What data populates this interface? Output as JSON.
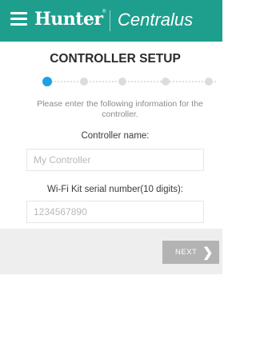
{
  "header": {
    "brand": "Hunter",
    "registered_mark": "®",
    "product": "Centralus",
    "colors": {
      "bar": "#1e9f8e",
      "text": "#ffffff"
    },
    "icon": "hamburger-menu-icon"
  },
  "setup": {
    "title": "CONTROLLER SETUP",
    "steps": {
      "total": 5,
      "current": 1,
      "active_color": "#1da1e6",
      "inactive_color": "#dcdcdc"
    },
    "instructions": "Please enter the following information for the controller.",
    "controller_name": {
      "label": "Controller name:",
      "placeholder": "My Controller",
      "value": ""
    },
    "serial_number": {
      "label": "Wi-Fi Kit serial number(10 digits):",
      "placeholder": "1234567890",
      "value": ""
    }
  },
  "footer": {
    "next_label": "NEXT",
    "next_icon": "chevron-right-icon",
    "next_color": "#b3b3b3"
  }
}
